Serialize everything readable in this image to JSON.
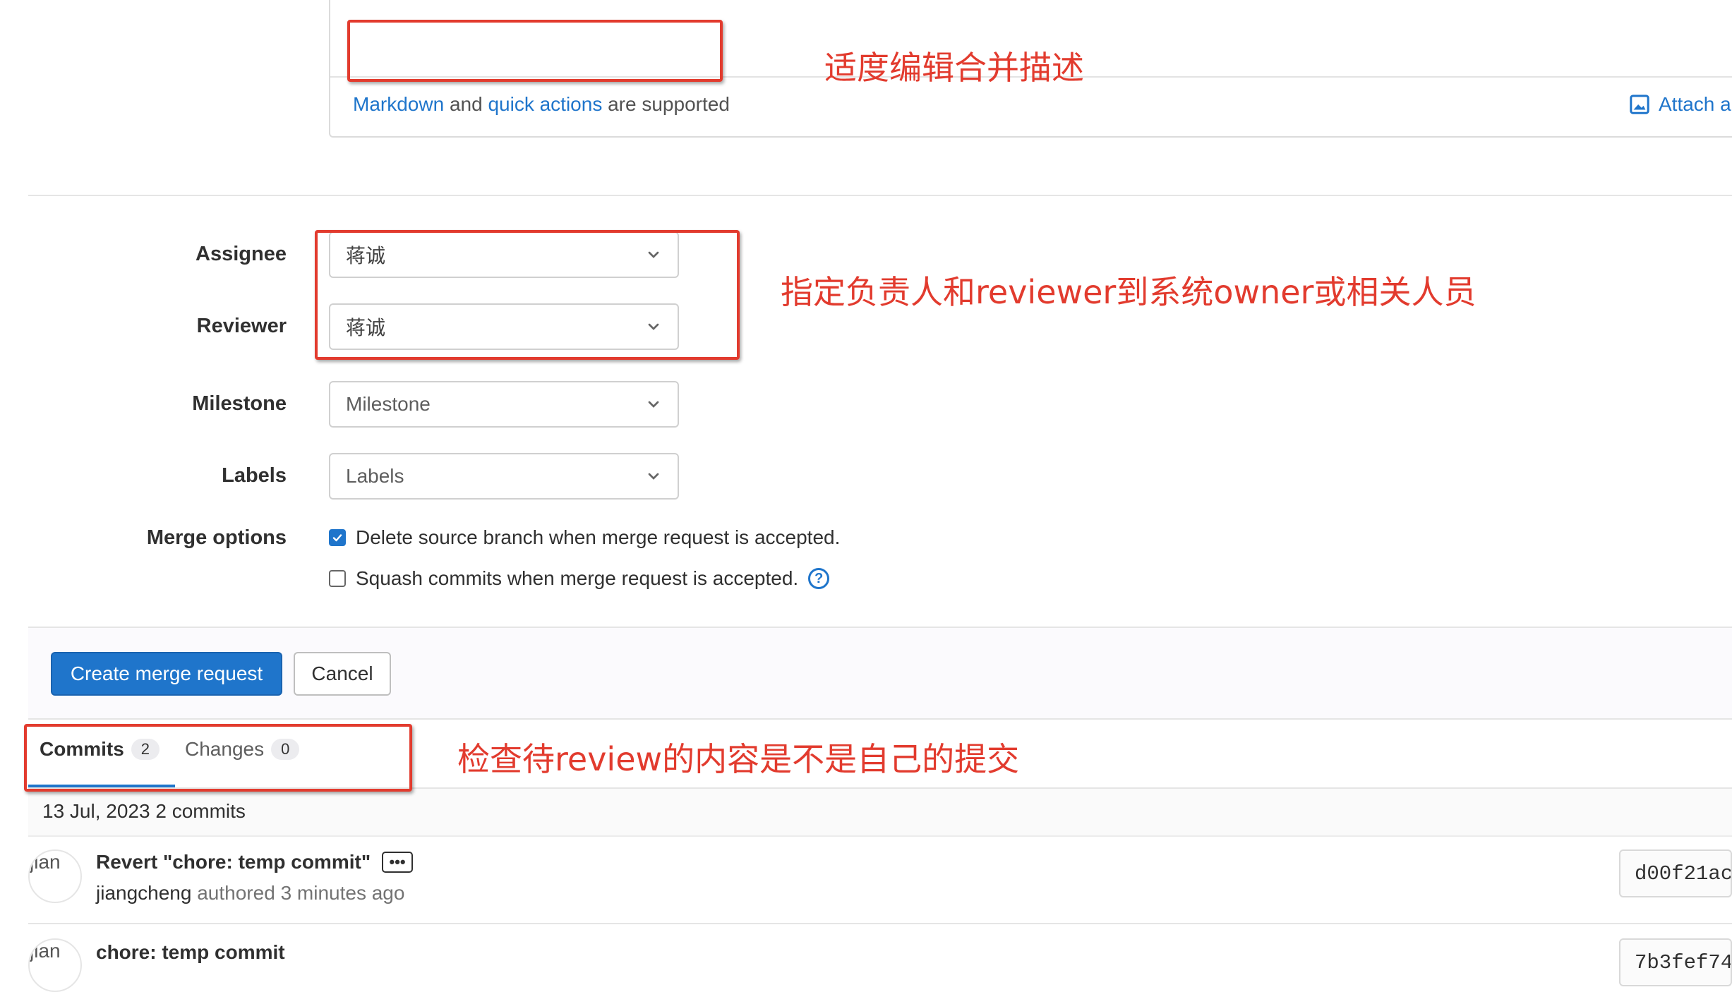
{
  "description": {
    "markdown_link": "Markdown",
    "and_text": "and",
    "quick_actions_link": "quick actions",
    "supported_text": "are supported",
    "attach_label": "Attach a"
  },
  "form": {
    "assignee": {
      "label": "Assignee",
      "value": "蒋诚"
    },
    "reviewer": {
      "label": "Reviewer",
      "value": "蒋诚"
    },
    "milestone": {
      "label": "Milestone",
      "placeholder": "Milestone"
    },
    "labels": {
      "label": "Labels",
      "placeholder": "Labels"
    },
    "merge_options": {
      "label": "Merge options",
      "delete_source": {
        "text": "Delete source branch when merge request is accepted.",
        "checked": true
      },
      "squash": {
        "text": "Squash commits when merge request is accepted.",
        "checked": false
      },
      "help_icon": "?"
    }
  },
  "actions": {
    "create_label": "Create merge request",
    "cancel_label": "Cancel"
  },
  "tabs": [
    {
      "label": "Commits",
      "count": "2",
      "active": true
    },
    {
      "label": "Changes",
      "count": "0",
      "active": false
    }
  ],
  "commits": {
    "date_header": "13 Jul, 2023 2 commits",
    "items": [
      {
        "avatar_alt": "jian",
        "title": "Revert \"chore: temp commit\"",
        "author": "jiangcheng",
        "authored": "authored",
        "time": "3 minutes ago",
        "sha": "d00f21ac"
      },
      {
        "avatar_alt": "jian",
        "title": "chore: temp commit",
        "sha": "7b3fef74"
      }
    ]
  },
  "annotations": {
    "desc_note": "适度编辑合并描述",
    "people_note": "指定负责人和reviewer到系统owner或相关人员",
    "commits_note": "检查待review的内容是不是自己的提交"
  },
  "colors": {
    "accent": "#1f75cb",
    "annotation_red": "#e23b2e"
  }
}
